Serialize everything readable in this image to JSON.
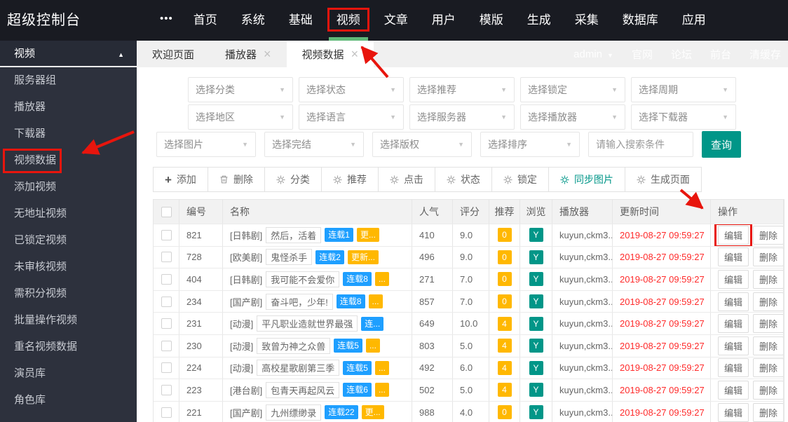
{
  "header": {
    "title": "超级控制台",
    "more_icon": "•••",
    "nav_items": [
      "首页",
      "系统",
      "基础",
      "视频",
      "文章",
      "用户",
      "模版",
      "生成",
      "采集",
      "数据库",
      "应用"
    ]
  },
  "userbar": {
    "username": "admin",
    "links": [
      "官网",
      "论坛",
      "前台",
      "清缓存"
    ]
  },
  "sidebar": {
    "group_label": "视频",
    "items": [
      "服务器组",
      "播放器",
      "下载器",
      "视频数据",
      "添加视频",
      "无地址视频",
      "已锁定视频",
      "未审核视频",
      "需积分视频",
      "批量操作视频",
      "重名视频数据",
      "演员库",
      "角色库"
    ]
  },
  "tabs": [
    {
      "label": "欢迎页面",
      "closable": false
    },
    {
      "label": "播放器",
      "closable": true
    },
    {
      "label": "视频数据",
      "closable": true,
      "active": true
    }
  ],
  "filters": {
    "row1": [
      "选择分类",
      "选择状态",
      "选择推荐",
      "选择锁定",
      "选择周期"
    ],
    "row2": [
      "选择地区",
      "选择语言",
      "选择服务器",
      "选择播放器",
      "选择下载器"
    ],
    "row3": [
      "选择图片",
      "选择完结",
      "选择版权",
      "选择排序"
    ],
    "search_placeholder": "请输入搜索条件",
    "query_label": "查询"
  },
  "toolbar": {
    "buttons": [
      {
        "label": "添加",
        "icon": "plus"
      },
      {
        "label": "删除",
        "icon": "trash"
      },
      {
        "label": "分类",
        "icon": "gear"
      },
      {
        "label": "推荐",
        "icon": "gear"
      },
      {
        "label": "点击",
        "icon": "gear"
      },
      {
        "label": "状态",
        "icon": "gear"
      },
      {
        "label": "锁定",
        "icon": "gear"
      },
      {
        "label": "同步图片",
        "icon": "gear",
        "accent": true
      },
      {
        "label": "生成页面",
        "icon": "gear"
      }
    ]
  },
  "table": {
    "columns": [
      "编号",
      "名称",
      "人气",
      "评分",
      "推荐",
      "浏览",
      "播放器",
      "更新时间",
      "操作"
    ],
    "actions": {
      "edit": "编辑",
      "delete": "删除"
    },
    "rows": [
      {
        "id": "821",
        "category": "[日韩剧]",
        "title": "然后，活着",
        "serial_badge": "连载1",
        "update_badge": "更...",
        "hits": "410",
        "score": "9.0",
        "recommend": "0",
        "view": "Y",
        "player": "kuyun,ckm3...",
        "updated": "2019-08-27 09:59:27"
      },
      {
        "id": "728",
        "category": "[欧美剧]",
        "title": "鬼怪杀手",
        "serial_badge": "连载2",
        "update_badge": "更新...",
        "hits": "496",
        "score": "9.0",
        "recommend": "0",
        "view": "Y",
        "player": "kuyun,ckm3...",
        "updated": "2019-08-27 09:59:27"
      },
      {
        "id": "404",
        "category": "[日韩剧]",
        "title": "我可能不会爱你",
        "serial_badge": "连载8",
        "update_badge": "...",
        "hits": "271",
        "score": "7.0",
        "recommend": "0",
        "view": "Y",
        "player": "kuyun,ckm3...",
        "updated": "2019-08-27 09:59:27"
      },
      {
        "id": "234",
        "category": "[国产剧]",
        "title": "奋斗吧，少年!",
        "serial_badge": "连载8",
        "update_badge": "...",
        "hits": "857",
        "score": "7.0",
        "recommend": "0",
        "view": "Y",
        "player": "kuyun,ckm3...",
        "updated": "2019-08-27 09:59:27"
      },
      {
        "id": "231",
        "category": "[动漫]",
        "title": "平凡职业造就世界最强",
        "serial_badge": "连...",
        "update_badge": "",
        "hits": "649",
        "score": "10.0",
        "recommend": "4",
        "view": "Y",
        "player": "kuyun,ckm3...",
        "updated": "2019-08-27 09:59:27"
      },
      {
        "id": "230",
        "category": "[动漫]",
        "title": "致曾为神之众兽",
        "serial_badge": "连载5",
        "update_badge": "...",
        "hits": "803",
        "score": "5.0",
        "recommend": "4",
        "view": "Y",
        "player": "kuyun,ckm3...",
        "updated": "2019-08-27 09:59:27"
      },
      {
        "id": "224",
        "category": "[动漫]",
        "title": "高校星歌剧第三季",
        "serial_badge": "连载5",
        "update_badge": "...",
        "hits": "492",
        "score": "6.0",
        "recommend": "4",
        "view": "Y",
        "player": "kuyun,ckm3...",
        "updated": "2019-08-27 09:59:27"
      },
      {
        "id": "223",
        "category": "[港台剧]",
        "title": "包青天再起风云",
        "serial_badge": "连载6",
        "update_badge": "...",
        "hits": "502",
        "score": "5.0",
        "recommend": "4",
        "view": "Y",
        "player": "kuyun,ckm3...",
        "updated": "2019-08-27 09:59:27"
      },
      {
        "id": "221",
        "category": "[国产剧]",
        "title": "九州缥缈录",
        "serial_badge": "连载22",
        "update_badge": "更...",
        "hits": "988",
        "score": "4.0",
        "recommend": "0",
        "view": "Y",
        "player": "kuyun,ckm3...",
        "updated": "2019-08-27 09:59:27"
      }
    ]
  },
  "annotations": {
    "nav_boxed": "视频",
    "nav_active": "视频",
    "sidebar_boxed": "视频数据",
    "edit_boxed_row": 0
  },
  "colors": {
    "accent_teal": "#009688",
    "badge_blue": "#1E9FFF",
    "badge_orange": "#FFB800",
    "nav_green": "#5FB878",
    "annotation_red": "#E8150D",
    "time_red": "#FF2B2B"
  }
}
